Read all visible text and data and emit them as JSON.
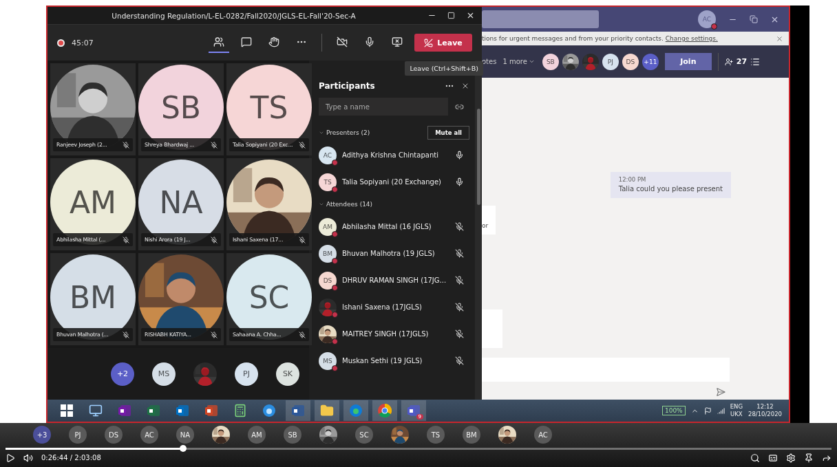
{
  "meeting": {
    "title": "Understanding Regulation/L-EL-0282/Fall2020/JGLS-EL-Fall'20-Sec-A",
    "recording": true,
    "timer": "45:07",
    "toolbar": [
      {
        "kind": "people",
        "selected": true
      },
      {
        "kind": "chat",
        "selected": false
      },
      {
        "kind": "hand",
        "selected": false
      },
      {
        "kind": "more",
        "selected": false
      }
    ],
    "controls": [
      {
        "kind": "camera-off"
      },
      {
        "kind": "mic"
      },
      {
        "kind": "stop-share"
      }
    ],
    "leave": "Leave",
    "tooltip": "Leave (Ctrl+Shift+B)",
    "tiles": [
      {
        "kind": "picture",
        "name": "Ranjeev Joseph (2...",
        "muted": true
      },
      {
        "kind": "initials",
        "initials": "SB",
        "color": "#f2d3dc",
        "name": "Shreya Bhardwaj ...",
        "muted": true
      },
      {
        "kind": "initials",
        "initials": "TS",
        "color": "#f6d6d6",
        "name": "Talia Sopiyani (20 Exc...",
        "muted": true
      },
      {
        "kind": "initials",
        "initials": "AM",
        "color": "#ecebd8",
        "name": "Abhilasha Mittal (...",
        "muted": true
      },
      {
        "kind": "initials",
        "initials": "NA",
        "color": "#d7dde6",
        "name": "Nishi Arora (19 J...",
        "muted": true
      },
      {
        "kind": "picture",
        "name": "Ishani Saxena (17...",
        "muted": true
      },
      {
        "kind": "initials",
        "initials": "BM",
        "color": "#d5dee7",
        "name": "Bhuvan Malhotra (...",
        "muted": true
      },
      {
        "kind": "picture",
        "name": "RISHABH KATIYA...",
        "muted": true
      },
      {
        "kind": "initials",
        "initials": "SC",
        "color": "#d9e9ef",
        "name": "Sahaana A. Chha...",
        "muted": true
      }
    ],
    "overflow": [
      {
        "kind": "count",
        "label": "+2"
      },
      {
        "kind": "initials",
        "label": "MS",
        "color": "#d5dee7"
      },
      {
        "kind": "picture"
      },
      {
        "kind": "initials",
        "label": "PJ",
        "color": "#d7e3ef"
      },
      {
        "kind": "initials",
        "label": "SK",
        "color": "#dde3e0"
      }
    ],
    "participants": {
      "title": "Participants",
      "placeholder": "Type a name",
      "groups": [
        {
          "label": "Presenters (2)",
          "expanded": true,
          "action": "Mute all",
          "people": [
            {
              "kind": "initials",
              "initials": "AC",
              "color": "#d8e6f0",
              "name": "Adithya Krishna Chintapanti",
              "muted": false
            },
            {
              "kind": "initials",
              "initials": "TS",
              "color": "#f6d6d6",
              "name": "Talia Sopiyani (20 Exchange)",
              "muted": false
            }
          ]
        },
        {
          "label": "Attendees (14)",
          "expanded": true,
          "people": [
            {
              "kind": "initials",
              "initials": "AM",
              "color": "#ecebd8",
              "name": "Abhilasha Mittal (16 JGLS)",
              "muted": true
            },
            {
              "kind": "initials",
              "initials": "BM",
              "color": "#d5dee7",
              "name": "Bhuvan Malhotra (19 JGLS)",
              "muted": true
            },
            {
              "kind": "initials",
              "initials": "DS",
              "color": "#f6d8d0",
              "name": "DHRUV RAMAN SINGH (17JG...",
              "muted": true
            },
            {
              "kind": "picture",
              "name": "Ishani Saxena (17JGLS)",
              "muted": true
            },
            {
              "kind": "picture",
              "name": "MAITREY SINGH (17JGLS)",
              "muted": true
            },
            {
              "kind": "initials",
              "initials": "MS",
              "color": "#d5dee7",
              "name": "Muskan Sethi (19 JGLS)",
              "muted": true
            }
          ]
        }
      ]
    }
  },
  "main": {
    "account": "AC",
    "banner": {
      "text": "tions for urgent messages and from your priority contacts.",
      "link": "Change settings."
    },
    "header": {
      "tab": "otes",
      "more": "1 more",
      "avatars": [
        {
          "kind": "initials",
          "label": "SB",
          "color": "#f2d3dc"
        },
        {
          "kind": "picture"
        },
        {
          "kind": "picture"
        },
        {
          "kind": "initials",
          "label": "PJ",
          "color": "#d7e3ef"
        },
        {
          "kind": "initials",
          "label": "DS",
          "color": "#f6d8d0"
        },
        {
          "kind": "count",
          "label": "+11"
        }
      ],
      "join": "Join",
      "count": "27"
    },
    "chat": {
      "time": "12:00 PM",
      "text": "Talia could you please present",
      "fragment": "or"
    }
  },
  "taskbar": {
    "apps": [
      {
        "kind": "start",
        "running": false
      },
      {
        "kind": "computer",
        "running": false
      },
      {
        "kind": "onenote",
        "running": false
      },
      {
        "kind": "excel",
        "running": false
      },
      {
        "kind": "outlook",
        "running": false
      },
      {
        "kind": "powerpoint",
        "running": false
      },
      {
        "kind": "calculator",
        "running": false
      },
      {
        "kind": "ie",
        "running": false
      },
      {
        "kind": "word",
        "running": true
      },
      {
        "kind": "folder",
        "running": true
      },
      {
        "kind": "edge",
        "running": true
      },
      {
        "kind": "chrome",
        "running": true
      },
      {
        "kind": "teams",
        "running": true,
        "badge": "9"
      }
    ],
    "battery": "100%",
    "language": "ENG",
    "layout": "UKX",
    "time": "12:12",
    "date": "28/10/2020"
  },
  "player": {
    "level": 0.215,
    "time": "0:26:44 / 2:03:08",
    "thumbnails": [
      {
        "kind": "count",
        "label": "+3"
      },
      {
        "kind": "initials",
        "label": "PJ"
      },
      {
        "kind": "initials",
        "label": "DS"
      },
      {
        "kind": "initials",
        "label": "AC"
      },
      {
        "kind": "initials",
        "label": "NA"
      },
      {
        "kind": "picture"
      },
      {
        "kind": "initials",
        "label": "AM"
      },
      {
        "kind": "initials",
        "label": "SB"
      },
      {
        "kind": "picture"
      },
      {
        "kind": "initials",
        "label": "SC"
      },
      {
        "kind": "picture"
      },
      {
        "kind": "initials",
        "label": "TS"
      },
      {
        "kind": "initials",
        "label": "BM"
      },
      {
        "kind": "picture"
      },
      {
        "kind": "initials",
        "label": "AC"
      }
    ]
  }
}
